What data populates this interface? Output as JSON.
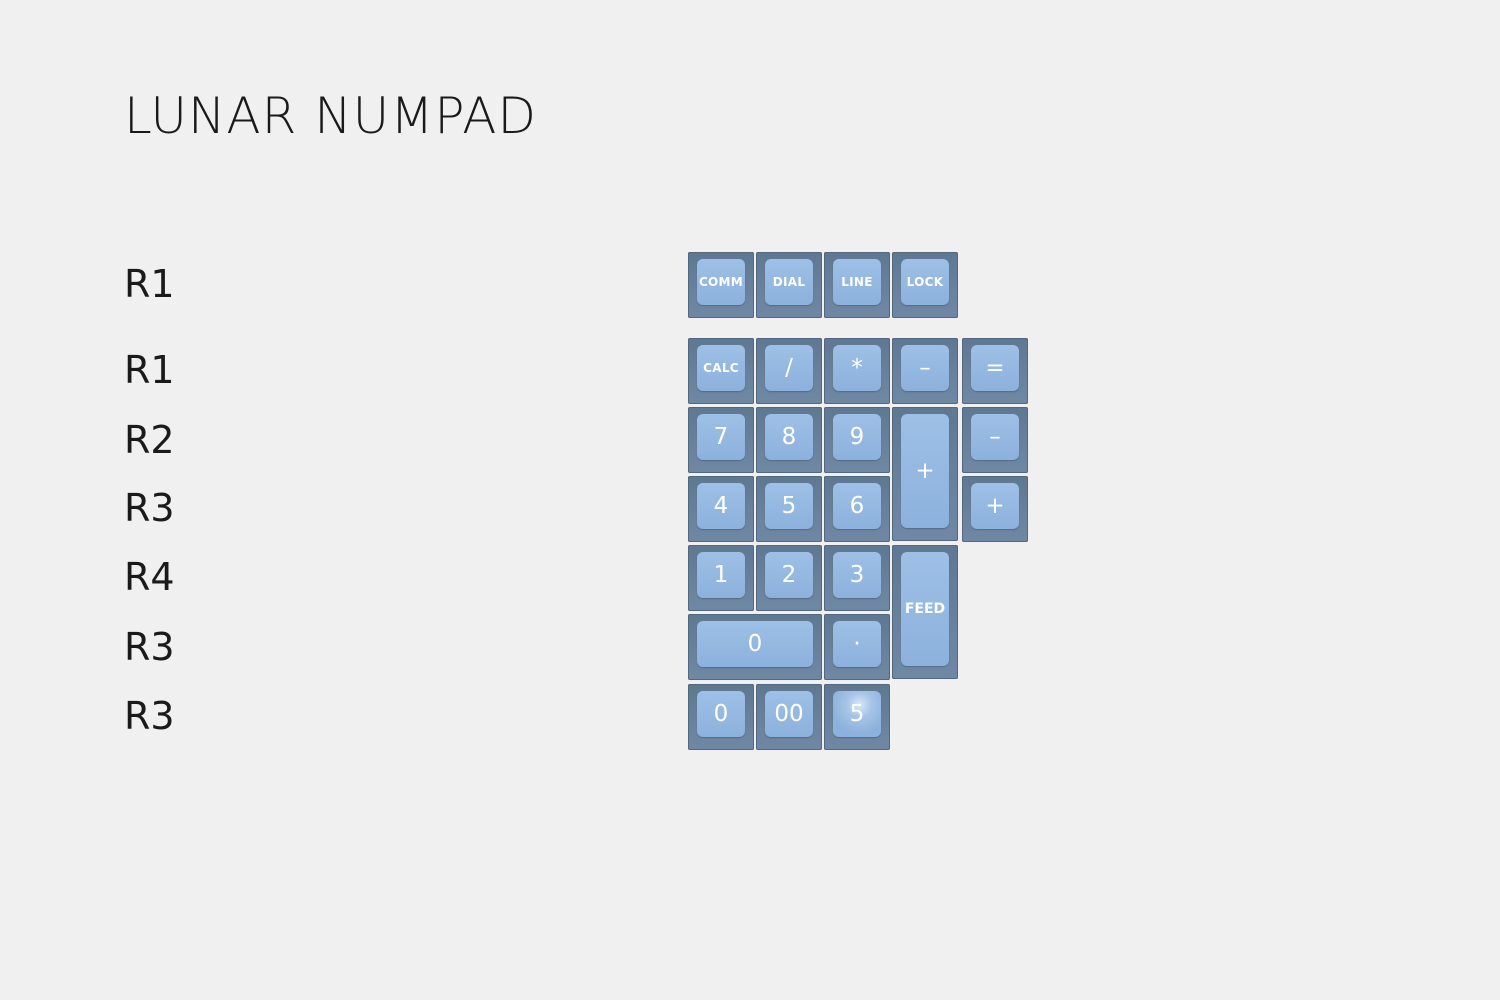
{
  "title": "LUNAR NUMPAD",
  "row_labels": [
    "R1",
    "R1",
    "R2",
    "R3",
    "R4",
    "R3",
    "R3"
  ],
  "colors": {
    "background": "#f0f0f0",
    "key_base": "#6a829c",
    "key_top": "#93b6df",
    "legend": "#ffffff"
  },
  "keys": {
    "comm": "COMM",
    "dial": "DIAL",
    "line": "LINE",
    "lock": "LOCK",
    "calc": "CALC",
    "divide": "/",
    "multiply": "*",
    "minus": "–",
    "equals": "=",
    "seven": "7",
    "eight": "8",
    "nine": "9",
    "plus_tall": "+",
    "minus_2": "–",
    "four": "4",
    "five": "5",
    "six": "6",
    "plus_2": "+",
    "one": "1",
    "two": "2",
    "three": "3",
    "feed": "FEED",
    "zero_wide": "0",
    "decimal": "·",
    "zero": "0",
    "double_zero": "00",
    "five_alt": "5"
  }
}
